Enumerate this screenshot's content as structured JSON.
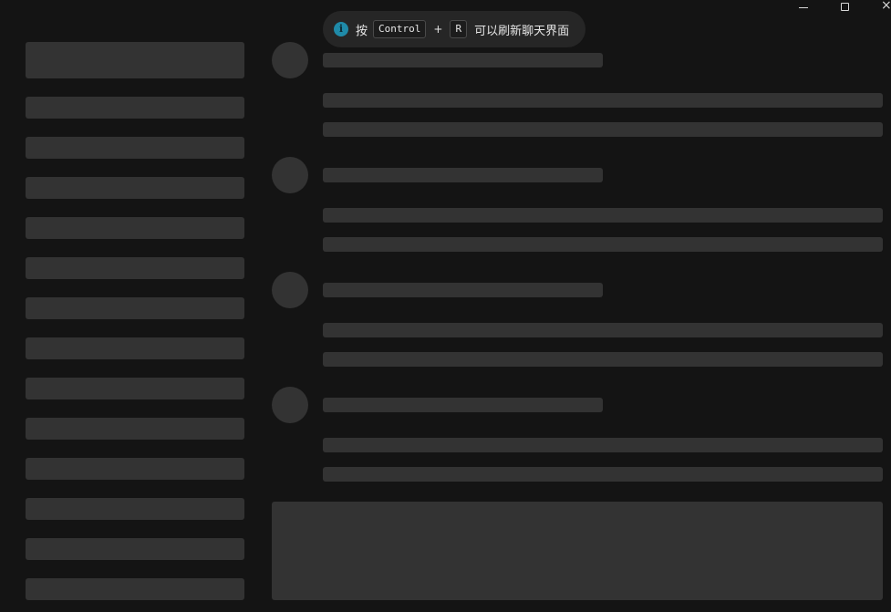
{
  "window_controls": {
    "minimize": "minimize",
    "maximize": "maximize",
    "close": "×"
  },
  "toast": {
    "icon": "info-icon",
    "prefix": "按",
    "key1": "Control",
    "plus": "+",
    "key2": "R",
    "suffix": "可以刷新聊天界面"
  },
  "state": "loading-skeleton",
  "colors": {
    "background": "#141414",
    "skeleton": "#333333",
    "toast_bg": "#262626",
    "info_accent": "#1f8aa8"
  }
}
